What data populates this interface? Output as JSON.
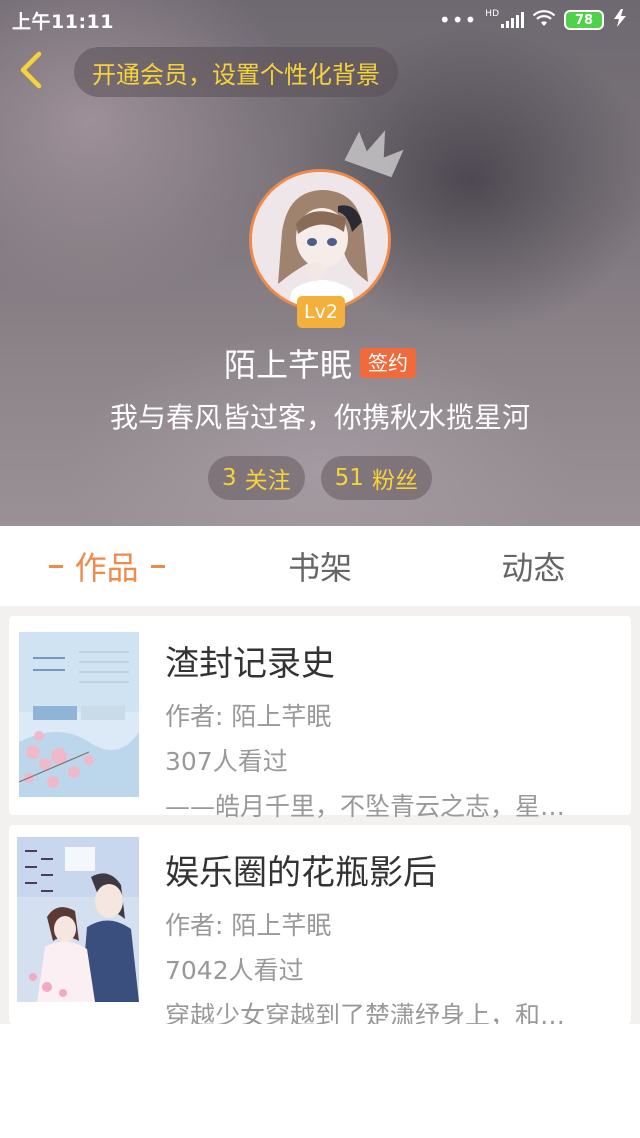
{
  "status_bar": {
    "time": "上午11:11",
    "dots": "•••",
    "network_badge": "HD",
    "battery": "78"
  },
  "header": {
    "back_icon": "chevron-left-icon",
    "vip_promo": "开通会员，设置个性化背景"
  },
  "profile": {
    "level": "Lv2",
    "name": "陌上芊眠",
    "signed_badge": "签约",
    "bio": "我与春风皆过客，你携秋水揽星河",
    "following": {
      "count": "3",
      "label": "关注"
    },
    "followers": {
      "count": "51",
      "label": "粉丝"
    }
  },
  "tabs": [
    {
      "label": "作品",
      "active": true
    },
    {
      "label": "书架",
      "active": false
    },
    {
      "label": "动态",
      "active": false
    }
  ],
  "works": [
    {
      "title": "渣封记录史",
      "author": "作者: 陌上芊眠",
      "views": "307人看过",
      "desc": "——皓月千里，不坠青云之志，星…"
    },
    {
      "title": "娱乐圈的花瓶影后",
      "author": "作者: 陌上芊眠",
      "views": "7042人看过",
      "desc": "穿越少女穿越到了楚潇纾身上，和…"
    }
  ],
  "colors": {
    "accent": "#f08a4a",
    "vip_text": "#f7d33a",
    "signed_bg": "#f06a3b",
    "level_bg": "#f3b13b"
  }
}
